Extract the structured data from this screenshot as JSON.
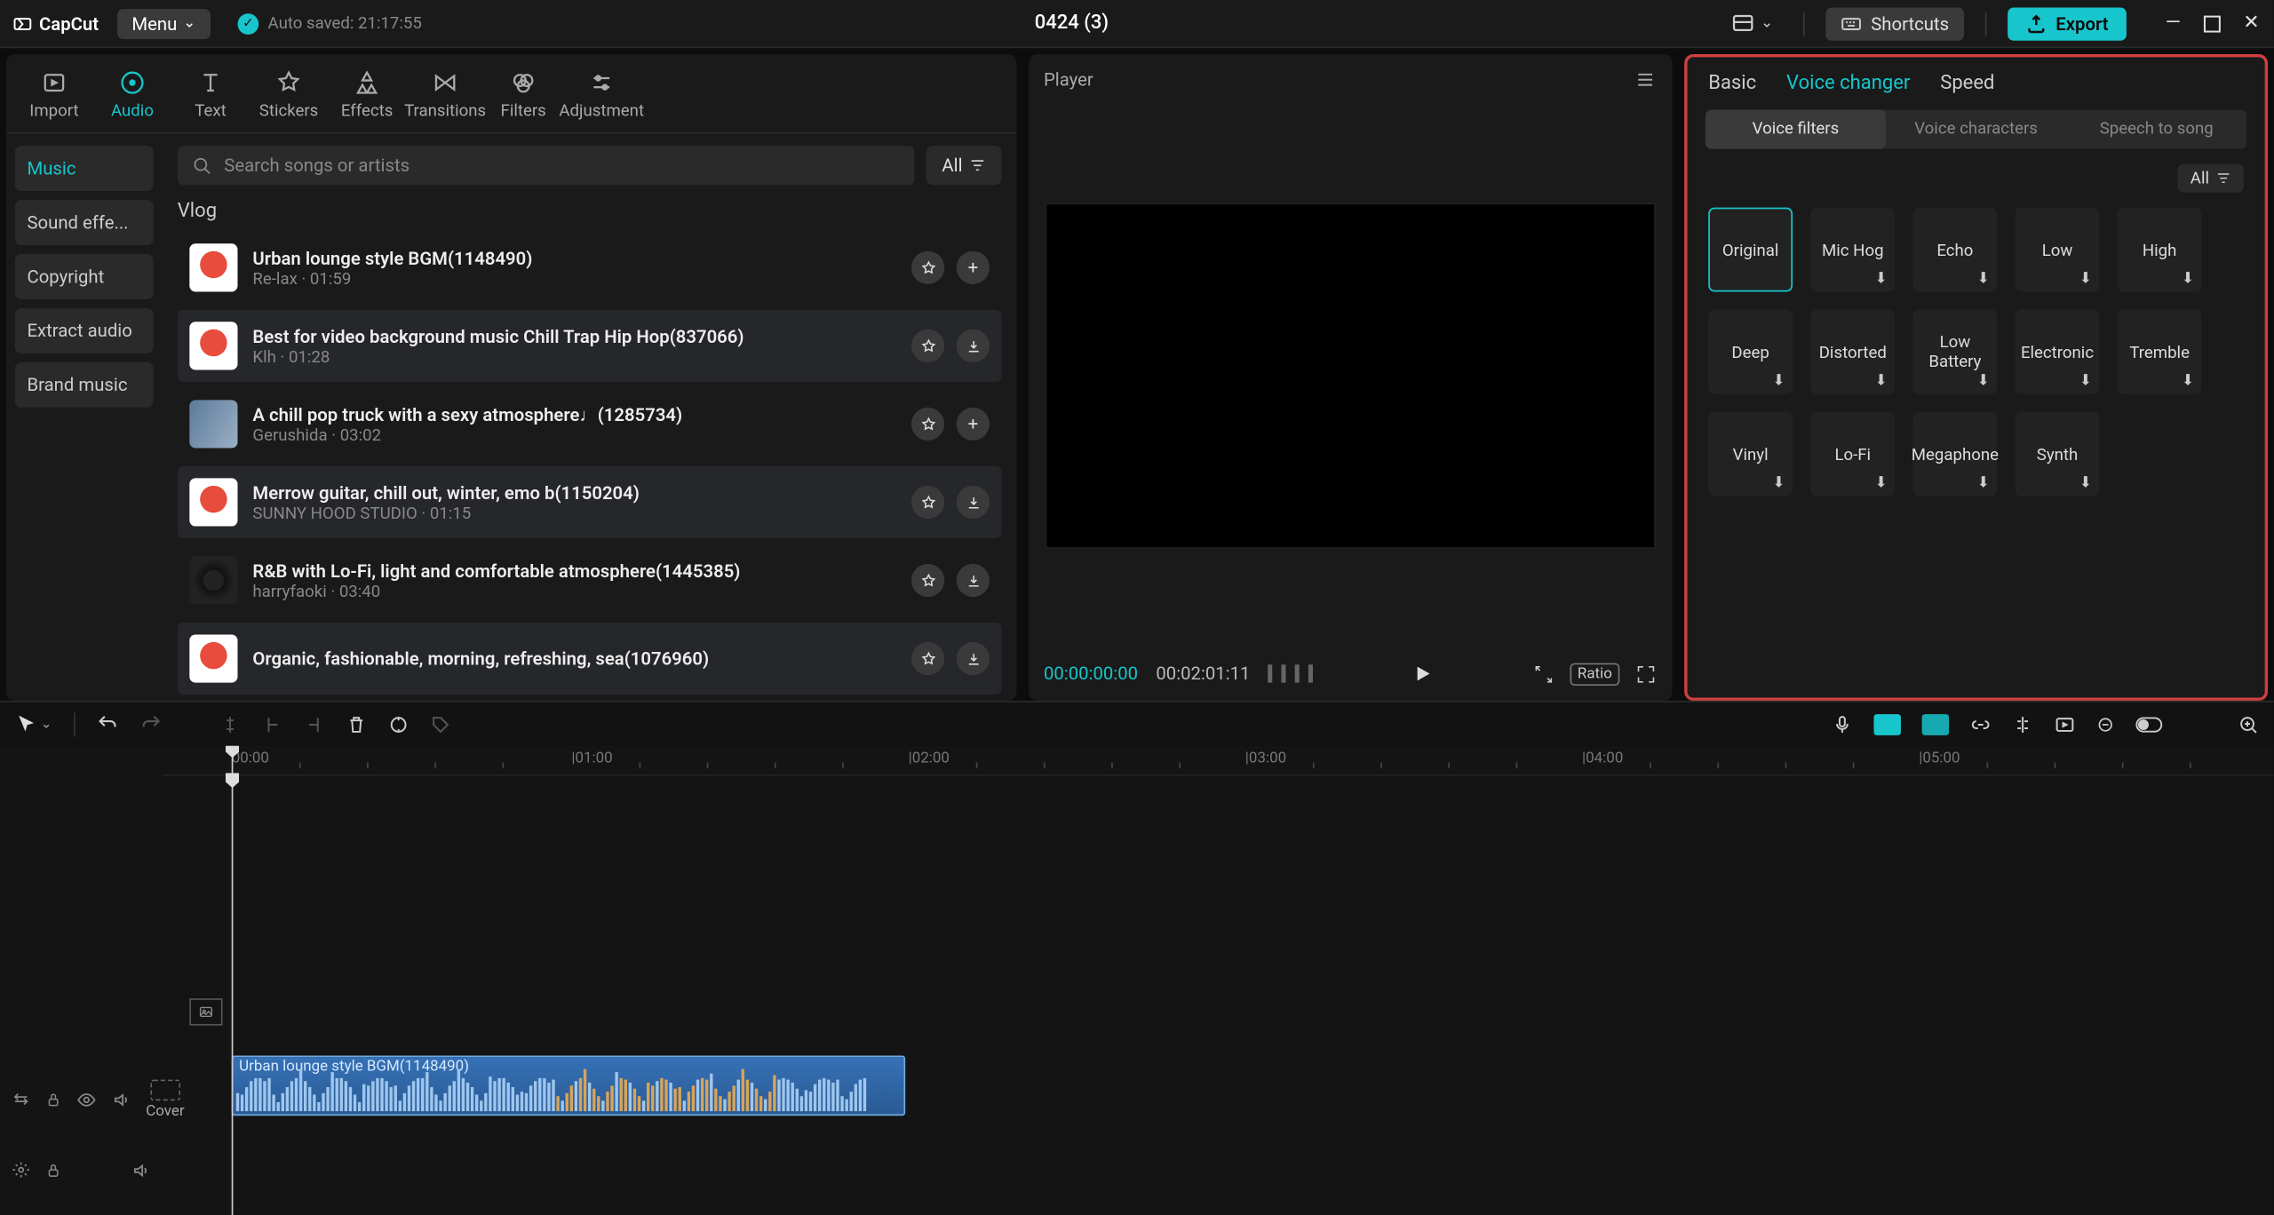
{
  "titlebar": {
    "app": "CapCut",
    "menu": "Menu",
    "autosave": "Auto saved: 21:17:55",
    "project": "0424 (3)",
    "shortcuts": "Shortcuts",
    "export": "Export"
  },
  "topTabs": [
    {
      "id": "import",
      "label": "Import"
    },
    {
      "id": "audio",
      "label": "Audio"
    },
    {
      "id": "text",
      "label": "Text"
    },
    {
      "id": "stickers",
      "label": "Stickers"
    },
    {
      "id": "effects",
      "label": "Effects"
    },
    {
      "id": "transitions",
      "label": "Transitions"
    },
    {
      "id": "filters",
      "label": "Filters"
    },
    {
      "id": "adjustment",
      "label": "Adjustment"
    }
  ],
  "sideNav": [
    {
      "label": "Music",
      "active": true
    },
    {
      "label": "Sound effe..."
    },
    {
      "label": "Copyright"
    },
    {
      "label": "Extract audio"
    },
    {
      "label": "Brand music"
    }
  ],
  "search": {
    "placeholder": "Search songs or artists",
    "all": "All"
  },
  "sectionTitle": "Vlog",
  "tracks": [
    {
      "title": "Urban lounge style BGM(1148490)",
      "meta": "Re-lax · 01:59",
      "thumb": "red",
      "alt": false,
      "plus": true
    },
    {
      "title": "Best for video background music Chill Trap Hip Hop(837066)",
      "meta": "Klh · 01:28",
      "thumb": "red",
      "alt": true,
      "plus": false
    },
    {
      "title": "A chill pop truck with a sexy atmosphere♩(1285734)",
      "meta": "Gerushida · 03:02",
      "thumb": "img",
      "alt": false,
      "plus": true
    },
    {
      "title": "Merrow guitar, chill out, winter, emo b(1150204)",
      "meta": "SUNNY HOOD STUDIO · 01:15",
      "thumb": "red",
      "alt": true,
      "plus": false
    },
    {
      "title": "R&B with Lo-Fi, light and comfortable atmosphere(1445385)",
      "meta": "harryfaoki · 03:40",
      "thumb": "vinyl",
      "alt": false,
      "plus": false
    },
    {
      "title": "Organic, fashionable, morning, refreshing, sea(1076960)",
      "meta": "",
      "thumb": "red",
      "alt": true,
      "plus": false
    }
  ],
  "player": {
    "title": "Player",
    "current": "00:00:00:00",
    "total": "00:02:01:11",
    "ratio": "Ratio"
  },
  "props": {
    "tabs": [
      "Basic",
      "Voice changer",
      "Speed"
    ],
    "activeTab": 1,
    "subTabs": [
      "Voice filters",
      "Voice characters",
      "Speech to song"
    ],
    "activeSub": 0,
    "all": "All",
    "filters": [
      {
        "label": "Original",
        "selected": true,
        "dl": false
      },
      {
        "label": "Mic Hog",
        "dl": true
      },
      {
        "label": "Echo",
        "dl": true
      },
      {
        "label": "Low",
        "dl": true
      },
      {
        "label": "High",
        "dl": true
      },
      {
        "label": "Deep",
        "dl": true
      },
      {
        "label": "Distorted",
        "dl": true
      },
      {
        "label": "Low Battery",
        "dl": true
      },
      {
        "label": "Electronic",
        "dl": true
      },
      {
        "label": "Tremble",
        "dl": true
      },
      {
        "label": "Vinyl",
        "dl": true
      },
      {
        "label": "Lo-Fi",
        "dl": true
      },
      {
        "label": "Megaphone",
        "dl": true
      },
      {
        "label": "Synth",
        "dl": true
      }
    ]
  },
  "timeline": {
    "cover": "Cover",
    "ticks": [
      {
        "label": "00:00",
        "pos": 46
      },
      {
        "label": "|01:00",
        "pos": 272
      },
      {
        "label": "|02:00",
        "pos": 496
      },
      {
        "label": "|03:00",
        "pos": 720
      },
      {
        "label": "|04:00",
        "pos": 944
      },
      {
        "label": "|05:00",
        "pos": 1168
      }
    ],
    "clip": {
      "title": "Urban lounge style BGM(1148490)"
    }
  }
}
